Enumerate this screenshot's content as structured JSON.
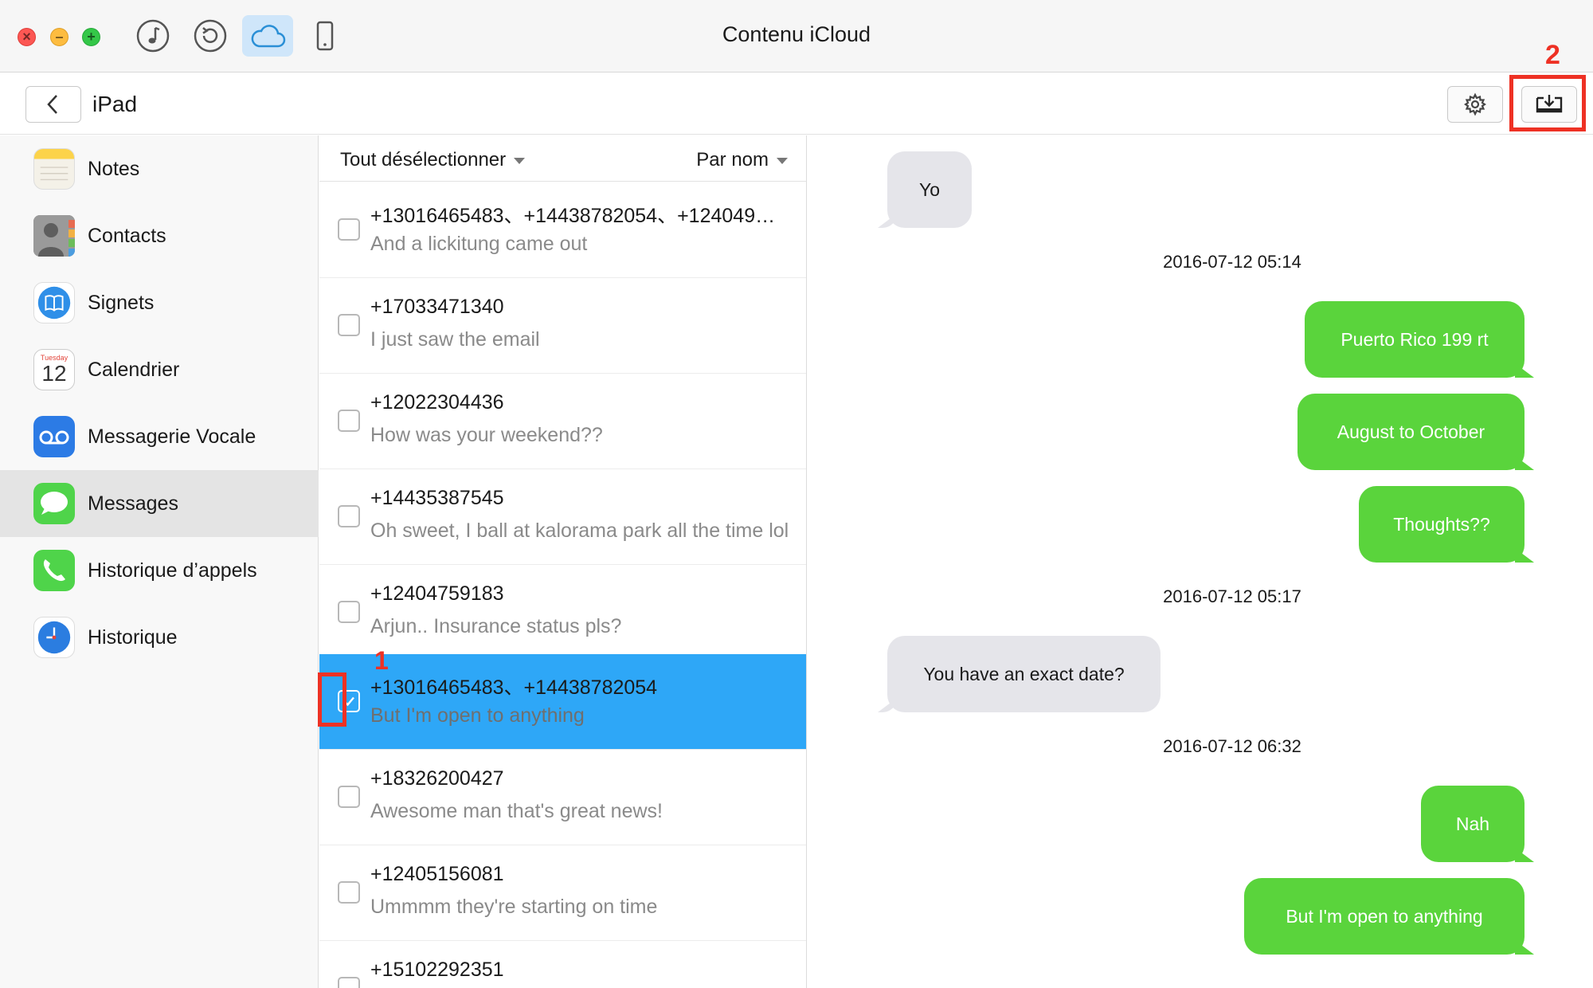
{
  "window": {
    "title": "Contenu iCloud",
    "traffic_lights": {
      "close": "×",
      "minimize": "–",
      "maximize": "+"
    },
    "tools": [
      "music-note-icon",
      "sync-icon",
      "cloud-icon",
      "phone-icon"
    ],
    "active_tool": "cloud-icon"
  },
  "toolbar": {
    "device": "iPad",
    "back_icon": "chevron-left-icon",
    "settings_icon": "gear-icon",
    "export_icon": "export-to-device-icon",
    "annotation_export": "2"
  },
  "sidebar": {
    "items": [
      {
        "label": "Notes",
        "icon": "notes-icon"
      },
      {
        "label": "Contacts",
        "icon": "contacts-icon"
      },
      {
        "label": "Signets",
        "icon": "bookmarks-icon"
      },
      {
        "label": "Calendrier",
        "icon": "calendar-icon",
        "icon_month": "Tuesday",
        "icon_day": "12"
      },
      {
        "label": "Messagerie Vocale",
        "icon": "voicemail-icon"
      },
      {
        "label": "Messages",
        "icon": "messages-icon",
        "selected": true
      },
      {
        "label": "Historique d’appels",
        "icon": "phone-call-icon"
      },
      {
        "label": "Historique",
        "icon": "clock-icon"
      }
    ]
  },
  "list": {
    "select_all_label": "Tout désélectionner",
    "sort_label": "Par nom",
    "annotation_checkbox": "1",
    "rows": [
      {
        "title": "+13016465483、+14438782054、+124049…",
        "preview": "And a lickitung came out",
        "checked": false
      },
      {
        "title": "+17033471340",
        "preview": "I just saw the email",
        "checked": false
      },
      {
        "title": "+12022304436",
        "preview": "How was your weekend??",
        "checked": false
      },
      {
        "title": "+14435387545",
        "preview": "Oh sweet, I ball at kalorama park all the time lol",
        "checked": false
      },
      {
        "title": "+12404759183",
        "preview": "Arjun.. Insurance status pls?",
        "checked": false
      },
      {
        "title": "+13016465483、+14438782054",
        "preview": "But I'm open to anything",
        "checked": true,
        "selected": true
      },
      {
        "title": "+18326200427",
        "preview": "Awesome man that's great news!",
        "checked": false
      },
      {
        "title": "+12405156081",
        "preview": "Ummmm they're starting on time",
        "checked": false
      },
      {
        "title": "+15102292351",
        "preview": "",
        "checked": false
      }
    ]
  },
  "conversation": {
    "items": [
      {
        "kind": "in",
        "text": "Yo"
      },
      {
        "kind": "time",
        "text": "2016-07-12 05:14"
      },
      {
        "kind": "out",
        "text": "Puerto Rico 199 rt"
      },
      {
        "kind": "out",
        "text": "August to October"
      },
      {
        "kind": "out",
        "text": "Thoughts??"
      },
      {
        "kind": "time",
        "text": "2016-07-12 05:17"
      },
      {
        "kind": "in",
        "text": "You have an exact date?"
      },
      {
        "kind": "time",
        "text": "2016-07-12 06:32"
      },
      {
        "kind": "out",
        "text": "Nah"
      },
      {
        "kind": "out",
        "text": "But I'm open to anything"
      }
    ]
  },
  "colors": {
    "accent_selected_row": "#2ea7f7",
    "outgoing_bubble": "#5ad43c",
    "incoming_bubble": "#e5e5ea",
    "annotation_red": "#ee3124"
  }
}
